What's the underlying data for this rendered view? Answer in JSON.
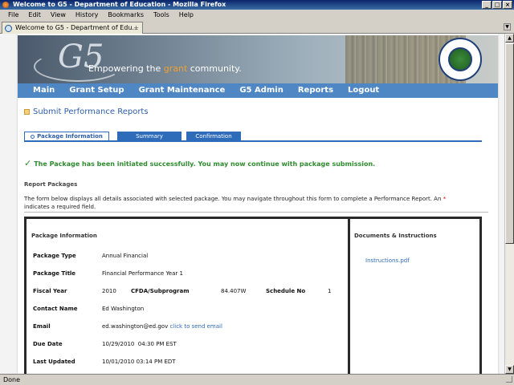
{
  "window": {
    "title": "Welcome to G5 - Department of Education - Mozilla Firefox",
    "menu": [
      "File",
      "Edit",
      "View",
      "History",
      "Bookmarks",
      "Tools",
      "Help"
    ],
    "tab_title": "Welcome to G5 - Department of Edu...",
    "status": "Done"
  },
  "banner": {
    "logo": "G5",
    "tagline_pre": "Empowering the ",
    "tagline_grant": "grant",
    "tagline_post": " community."
  },
  "nav": [
    "Main",
    "Grant Setup",
    "Grant Maintenance",
    "G5 Admin",
    "Reports",
    "Logout"
  ],
  "page": {
    "title": "Submit Performance Reports",
    "tabs": [
      "Package Information",
      "Summary",
      "Confirmation"
    ],
    "success": "The Package has been initiated successfully. You may now continue with package submission.",
    "section_heading": "Report Packages",
    "description": "The form below displays all details associated with selected package. You may navigate throughout this form to complete a Performance Report.  An",
    "description_tail": "indicates a required field.",
    "required_mark": "*"
  },
  "package": {
    "heading": "Package Information",
    "type_label": "Package Type",
    "type_value": "Annual Financial",
    "title_label": "Package Title",
    "title_value": "Financial Performance Year 1",
    "fy_label": "Fiscal Year",
    "fy_value": "2010",
    "cfda_label": "CFDA/Subprogram",
    "cfda_value": "84.407W",
    "sched_label": "Schedule No",
    "sched_value": "1",
    "contact_label": "Contact Name",
    "contact_value": "Ed Washington",
    "email_label": "Email",
    "email_value": "ed.washington@ed.gov",
    "email_link": "click to send email",
    "due_label": "Due Date",
    "due_value": "10/29/2010  04:30 PM EST",
    "updated_label": "Last Updated",
    "updated_value": "10/01/2010 03:14 PM EDT"
  },
  "documents": {
    "heading": "Documents & Instructions",
    "file": "Instructions.pdf"
  }
}
